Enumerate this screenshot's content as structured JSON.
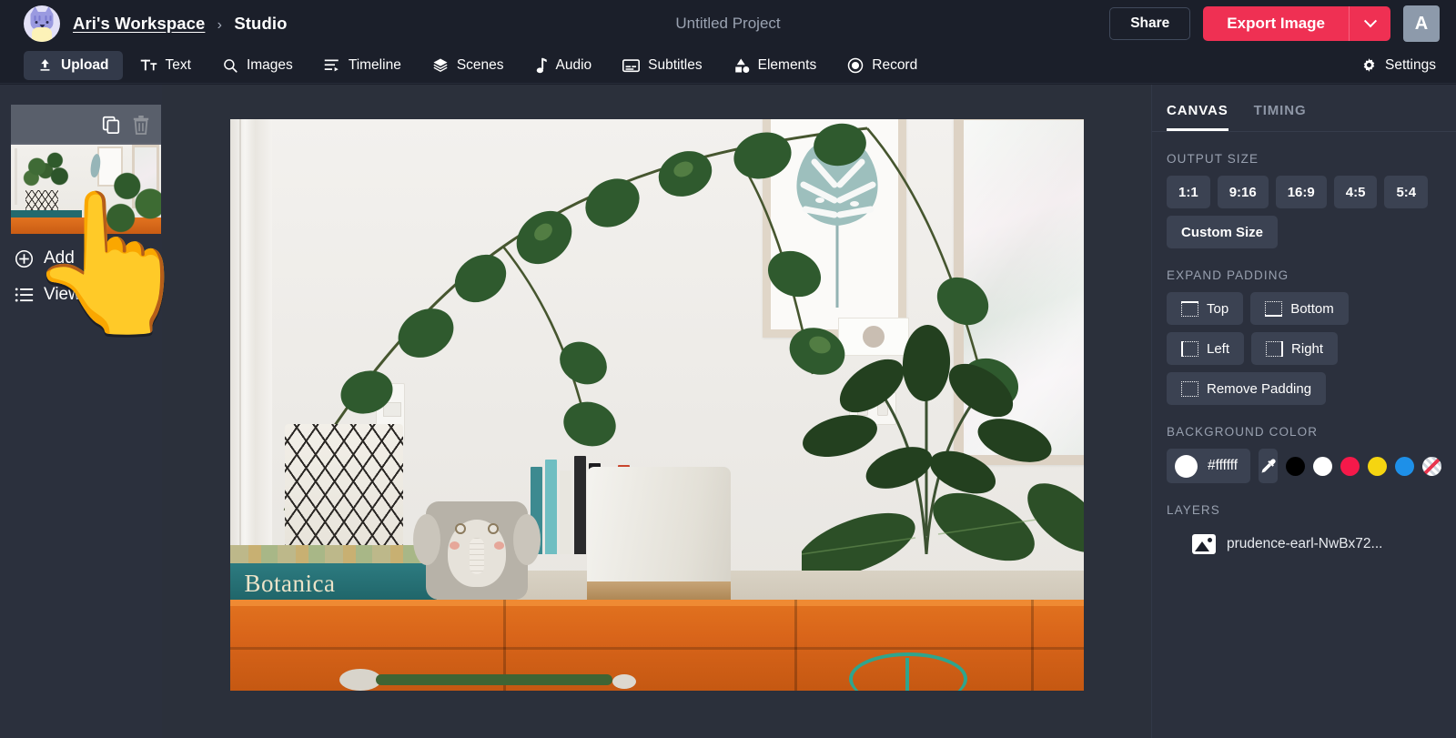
{
  "topbar": {
    "avatar_icon": "cat-avatar",
    "workspace": "Ari's Workspace",
    "separator": "›",
    "section": "Studio",
    "project_title": "Untitled Project",
    "share_label": "Share",
    "export_label": "Export Image",
    "export_caret_icon": "chevron-down-icon",
    "user_initial": "A",
    "accent_color": "#ef3053"
  },
  "toolbar": {
    "items": [
      {
        "label": "Upload",
        "icon": "upload-icon",
        "active": true
      },
      {
        "label": "Text",
        "icon": "text-icon",
        "active": false
      },
      {
        "label": "Images",
        "icon": "search-icon",
        "active": false
      },
      {
        "label": "Timeline",
        "icon": "timeline-icon",
        "active": false
      },
      {
        "label": "Scenes",
        "icon": "layers-icon",
        "active": false
      },
      {
        "label": "Audio",
        "icon": "music-note-icon",
        "active": false
      },
      {
        "label": "Subtitles",
        "icon": "subtitles-icon",
        "active": false
      },
      {
        "label": "Elements",
        "icon": "shapes-icon",
        "active": false
      },
      {
        "label": "Record",
        "icon": "record-icon",
        "active": false
      }
    ],
    "settings_label": "Settings",
    "settings_icon": "gear-icon"
  },
  "sidebar": {
    "thumbnail": {
      "copy_icon": "copy-icon",
      "delete_icon": "trash-icon"
    },
    "add_label": "Add",
    "add_icon": "plus-circle-icon",
    "view_all_label": "View All",
    "view_all_icon": "list-icon",
    "cursor_icon": "pointing-hand-cursor"
  },
  "right_panel": {
    "tabs": [
      {
        "label": "CANVAS",
        "active": true
      },
      {
        "label": "TIMING",
        "active": false
      }
    ],
    "output_size": {
      "label": "OUTPUT SIZE",
      "presets": [
        "1:1",
        "9:16",
        "16:9",
        "4:5",
        "5:4"
      ],
      "custom_label": "Custom Size"
    },
    "expand_padding": {
      "label": "EXPAND PADDING",
      "buttons": [
        {
          "label": "Top",
          "icon": "padding-top-icon"
        },
        {
          "label": "Bottom",
          "icon": "padding-bottom-icon"
        },
        {
          "label": "Left",
          "icon": "padding-left-icon"
        },
        {
          "label": "Right",
          "icon": "padding-right-icon"
        },
        {
          "label": "Remove Padding",
          "icon": "padding-remove-icon"
        }
      ]
    },
    "background_color": {
      "label": "BACKGROUND COLOR",
      "value": "#ffffff",
      "eyedropper_icon": "eyedropper-icon",
      "swatches": [
        "#000000",
        "#ffffff",
        "#f5194a",
        "#f5d511",
        "#1e90e8",
        "transparent"
      ]
    },
    "layers": {
      "label": "LAYERS",
      "items": [
        {
          "name": "prudence-earl-NwBx72...",
          "icon": "image-icon"
        }
      ]
    }
  }
}
